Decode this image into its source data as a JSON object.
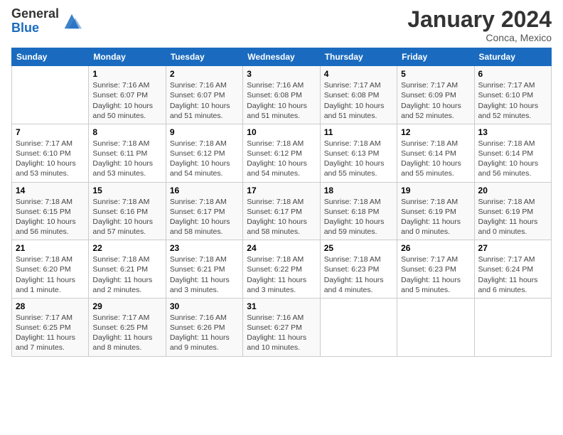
{
  "logo": {
    "general": "General",
    "blue": "Blue"
  },
  "header": {
    "month_year": "January 2024",
    "location": "Conca, Mexico"
  },
  "days_of_week": [
    "Sunday",
    "Monday",
    "Tuesday",
    "Wednesday",
    "Thursday",
    "Friday",
    "Saturday"
  ],
  "weeks": [
    [
      {
        "day": "",
        "info": ""
      },
      {
        "day": "1",
        "info": "Sunrise: 7:16 AM\nSunset: 6:07 PM\nDaylight: 10 hours\nand 50 minutes."
      },
      {
        "day": "2",
        "info": "Sunrise: 7:16 AM\nSunset: 6:07 PM\nDaylight: 10 hours\nand 51 minutes."
      },
      {
        "day": "3",
        "info": "Sunrise: 7:16 AM\nSunset: 6:08 PM\nDaylight: 10 hours\nand 51 minutes."
      },
      {
        "day": "4",
        "info": "Sunrise: 7:17 AM\nSunset: 6:08 PM\nDaylight: 10 hours\nand 51 minutes."
      },
      {
        "day": "5",
        "info": "Sunrise: 7:17 AM\nSunset: 6:09 PM\nDaylight: 10 hours\nand 52 minutes."
      },
      {
        "day": "6",
        "info": "Sunrise: 7:17 AM\nSunset: 6:10 PM\nDaylight: 10 hours\nand 52 minutes."
      }
    ],
    [
      {
        "day": "7",
        "info": "Sunrise: 7:17 AM\nSunset: 6:10 PM\nDaylight: 10 hours\nand 53 minutes."
      },
      {
        "day": "8",
        "info": "Sunrise: 7:18 AM\nSunset: 6:11 PM\nDaylight: 10 hours\nand 53 minutes."
      },
      {
        "day": "9",
        "info": "Sunrise: 7:18 AM\nSunset: 6:12 PM\nDaylight: 10 hours\nand 54 minutes."
      },
      {
        "day": "10",
        "info": "Sunrise: 7:18 AM\nSunset: 6:12 PM\nDaylight: 10 hours\nand 54 minutes."
      },
      {
        "day": "11",
        "info": "Sunrise: 7:18 AM\nSunset: 6:13 PM\nDaylight: 10 hours\nand 55 minutes."
      },
      {
        "day": "12",
        "info": "Sunrise: 7:18 AM\nSunset: 6:14 PM\nDaylight: 10 hours\nand 55 minutes."
      },
      {
        "day": "13",
        "info": "Sunrise: 7:18 AM\nSunset: 6:14 PM\nDaylight: 10 hours\nand 56 minutes."
      }
    ],
    [
      {
        "day": "14",
        "info": "Sunrise: 7:18 AM\nSunset: 6:15 PM\nDaylight: 10 hours\nand 56 minutes."
      },
      {
        "day": "15",
        "info": "Sunrise: 7:18 AM\nSunset: 6:16 PM\nDaylight: 10 hours\nand 57 minutes."
      },
      {
        "day": "16",
        "info": "Sunrise: 7:18 AM\nSunset: 6:17 PM\nDaylight: 10 hours\nand 58 minutes."
      },
      {
        "day": "17",
        "info": "Sunrise: 7:18 AM\nSunset: 6:17 PM\nDaylight: 10 hours\nand 58 minutes."
      },
      {
        "day": "18",
        "info": "Sunrise: 7:18 AM\nSunset: 6:18 PM\nDaylight: 10 hours\nand 59 minutes."
      },
      {
        "day": "19",
        "info": "Sunrise: 7:18 AM\nSunset: 6:19 PM\nDaylight: 11 hours\nand 0 minutes."
      },
      {
        "day": "20",
        "info": "Sunrise: 7:18 AM\nSunset: 6:19 PM\nDaylight: 11 hours\nand 0 minutes."
      }
    ],
    [
      {
        "day": "21",
        "info": "Sunrise: 7:18 AM\nSunset: 6:20 PM\nDaylight: 11 hours\nand 1 minute."
      },
      {
        "day": "22",
        "info": "Sunrise: 7:18 AM\nSunset: 6:21 PM\nDaylight: 11 hours\nand 2 minutes."
      },
      {
        "day": "23",
        "info": "Sunrise: 7:18 AM\nSunset: 6:21 PM\nDaylight: 11 hours\nand 3 minutes."
      },
      {
        "day": "24",
        "info": "Sunrise: 7:18 AM\nSunset: 6:22 PM\nDaylight: 11 hours\nand 3 minutes."
      },
      {
        "day": "25",
        "info": "Sunrise: 7:18 AM\nSunset: 6:23 PM\nDaylight: 11 hours\nand 4 minutes."
      },
      {
        "day": "26",
        "info": "Sunrise: 7:17 AM\nSunset: 6:23 PM\nDaylight: 11 hours\nand 5 minutes."
      },
      {
        "day": "27",
        "info": "Sunrise: 7:17 AM\nSunset: 6:24 PM\nDaylight: 11 hours\nand 6 minutes."
      }
    ],
    [
      {
        "day": "28",
        "info": "Sunrise: 7:17 AM\nSunset: 6:25 PM\nDaylight: 11 hours\nand 7 minutes."
      },
      {
        "day": "29",
        "info": "Sunrise: 7:17 AM\nSunset: 6:25 PM\nDaylight: 11 hours\nand 8 minutes."
      },
      {
        "day": "30",
        "info": "Sunrise: 7:16 AM\nSunset: 6:26 PM\nDaylight: 11 hours\nand 9 minutes."
      },
      {
        "day": "31",
        "info": "Sunrise: 7:16 AM\nSunset: 6:27 PM\nDaylight: 11 hours\nand 10 minutes."
      },
      {
        "day": "",
        "info": ""
      },
      {
        "day": "",
        "info": ""
      },
      {
        "day": "",
        "info": ""
      }
    ]
  ]
}
